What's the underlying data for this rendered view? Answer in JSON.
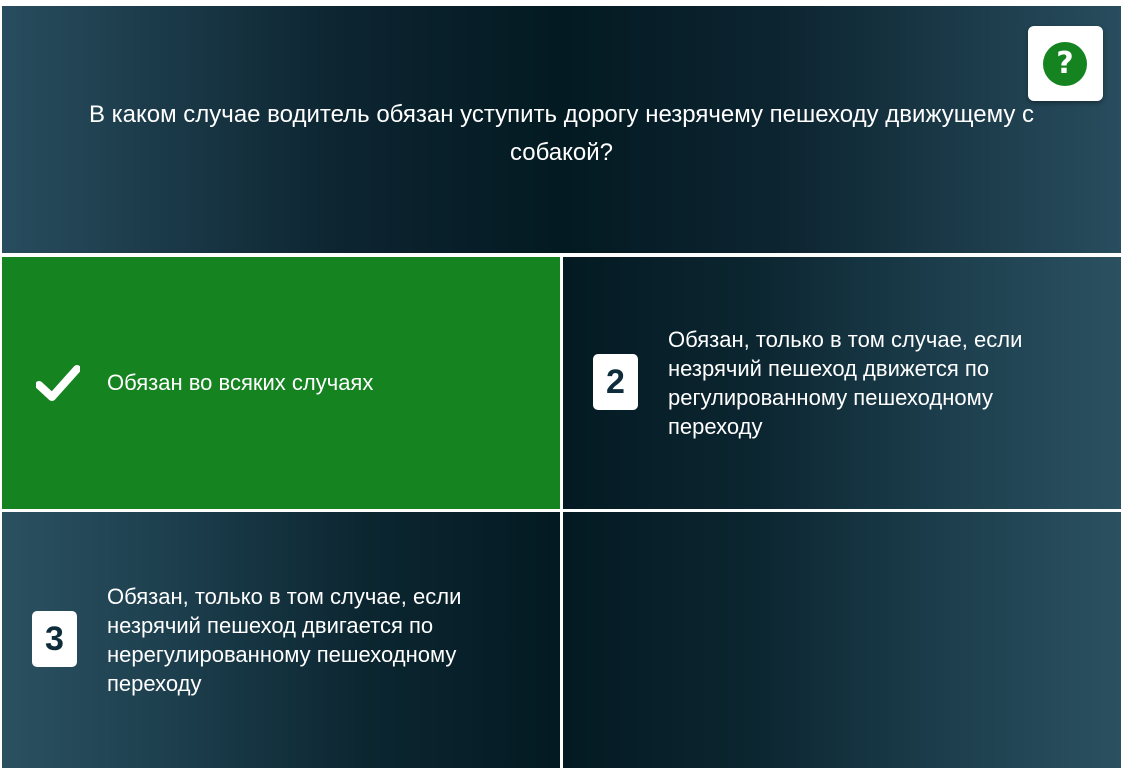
{
  "question": {
    "text": "В каком случае водитель обязан уступить дорогу незрячему пешеходу движущему с собакой?",
    "help_label": "?"
  },
  "answers": [
    {
      "number": "",
      "text": "Обязан во всяких случаях",
      "state": "correct"
    },
    {
      "number": "2",
      "text": "Обязан, только в том случае, если незрячий пешеход движется по регулированному пешеходному переходу"
    },
    {
      "number": "3",
      "text": "Обязан, только в том случае, если незрячий пешеход двигается по нерегулированному пешеходному переходу"
    }
  ],
  "colors": {
    "correct": "#148320",
    "badge_text": "#0e2c3a",
    "panel_dark": "#031a22",
    "panel_light": "#2b5161"
  },
  "icons": {
    "help": "question-circle-icon",
    "correct": "checkmark-icon"
  }
}
